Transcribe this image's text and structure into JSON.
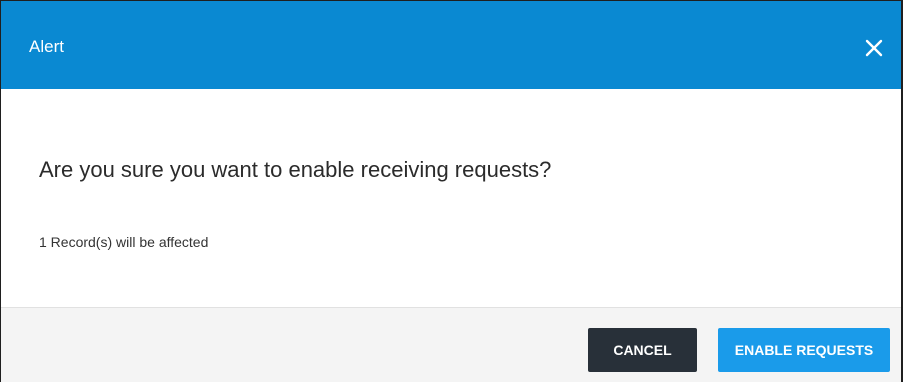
{
  "dialog": {
    "title": "Alert",
    "close_icon": "close-icon",
    "message": "Are you sure you want to enable receiving requests?",
    "affected_text": "1 Record(s) will be affected"
  },
  "footer": {
    "cancel_label": "CANCEL",
    "confirm_label": "ENABLE REQUESTS"
  },
  "colors": {
    "header": "#0a89d2",
    "cancel_button": "#283039",
    "confirm_button": "#1a9bea",
    "footer_bg": "#f4f4f4"
  }
}
